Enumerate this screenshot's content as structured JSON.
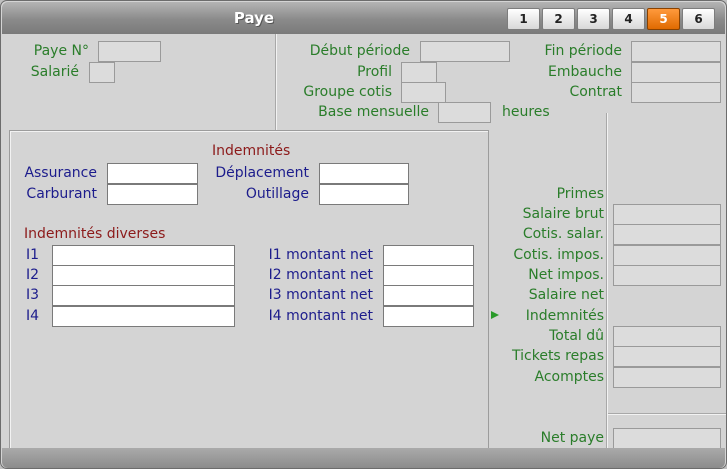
{
  "window": {
    "title": "Paye"
  },
  "tabs": [
    {
      "label": "1",
      "active": false
    },
    {
      "label": "2",
      "active": false
    },
    {
      "label": "3",
      "active": false
    },
    {
      "label": "4",
      "active": false
    },
    {
      "label": "5",
      "active": true
    },
    {
      "label": "6",
      "active": false
    }
  ],
  "header": {
    "paye_no_label": "Paye N°",
    "salarie_label": "Salarié",
    "debut_periode_label": "Début période",
    "profil_label": "Profil",
    "groupe_cotis_label": "Groupe cotis",
    "base_mensuelle_label": "Base mensuelle",
    "heures_label": "heures",
    "fin_periode_label": "Fin période",
    "embauche_label": "Embauche",
    "contrat_label": "Contrat"
  },
  "indemnites": {
    "title": "Indemnités",
    "assurance_label": "Assurance",
    "carburant_label": "Carburant",
    "deplacement_label": "Déplacement",
    "outillage_label": "Outillage"
  },
  "indemnites_diverses": {
    "title": "Indemnités diverses",
    "rows": [
      {
        "label": "I1",
        "amount_label": "I1 montant net"
      },
      {
        "label": "I2",
        "amount_label": "I2 montant net"
      },
      {
        "label": "I3",
        "amount_label": "I3 montant net"
      },
      {
        "label": "I4",
        "amount_label": "I4 montant net"
      }
    ]
  },
  "summary": {
    "primes_label": "Primes",
    "salaire_brut_label": "Salaire brut",
    "cotis_salar_label": "Cotis. salar.",
    "cotis_impos_label": "Cotis. impos.",
    "net_impos_label": "Net impos.",
    "salaire_net_label": "Salaire net",
    "indemnites_label": "Indemnités",
    "total_du_label": "Total dû",
    "tickets_repas_label": "Tickets repas",
    "acomptes_label": "Acomptes",
    "net_paye_label": "Net paye"
  },
  "colors": {
    "label_green": "#2a7d2a",
    "label_blue": "#1c1c8c",
    "title_red": "#8c1a1a",
    "active_tab": "#e06a00"
  },
  "icons": {
    "current_row_marker": "arrow-right-icon"
  }
}
